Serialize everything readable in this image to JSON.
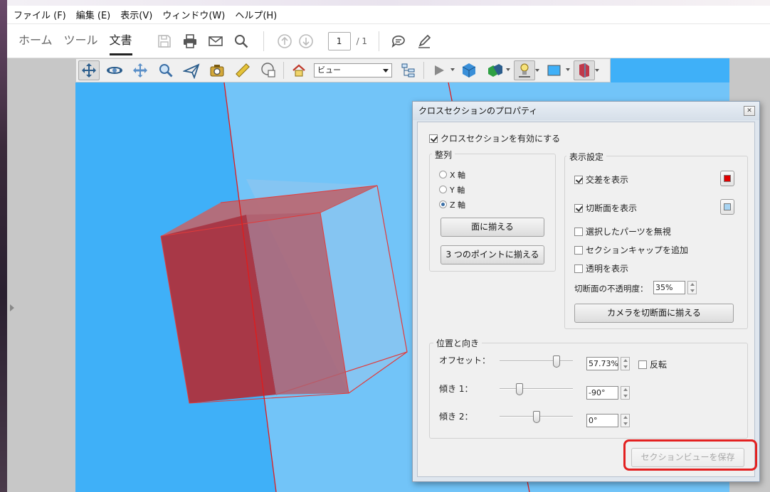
{
  "menu": [
    "ファイル (F)",
    "編集 (E)",
    "表示(V)",
    "ウィンドウ(W)",
    "ヘルプ(H)"
  ],
  "tabs": [
    {
      "label": "ホーム"
    },
    {
      "label": "ツール"
    },
    {
      "label": "文書"
    }
  ],
  "page": {
    "current": "1",
    "total": "/ 1"
  },
  "toolbar3d": {
    "view_select": "ビュー"
  },
  "colors": {
    "scene_bg": "#3fb0f8",
    "intersection_color": "#e00000",
    "cut_plane_color": "#a8d4f2",
    "highlight": "#e32020"
  },
  "dialog": {
    "title": "クロスセクションのプロパティ",
    "enable_label": "クロスセクションを有効にする",
    "enable_checked": true,
    "align": {
      "title": "整列",
      "options": [
        "X 軸",
        "Y 軸",
        "Z 軸"
      ],
      "selected": "Z 軸",
      "face_button": "面に揃える",
      "three_point_button": "3 つのポイントに揃える"
    },
    "display": {
      "title": "表示設定",
      "show_intersection": "交差を表示",
      "show_intersection_checked": true,
      "show_cut_plane": "切断面を表示",
      "show_cut_plane_checked": true,
      "ignore_selected": "選択したパーツを無視",
      "add_section_cap": "セクションキャップを追加",
      "show_transparency": "透明を表示",
      "opacity_label": "切断面の不透明度：",
      "opacity_value": "35%",
      "align_camera_button": "カメラを切断面に揃える"
    },
    "position": {
      "title": "位置と向き",
      "offset_label": "オフセット：",
      "offset_value": "57.73%",
      "offset_level": 0.78,
      "flip_label": "反転",
      "tilt1_label": "傾き 1：",
      "tilt1_value": "-90°",
      "tilt1_level": 0.27,
      "tilt2_label": "傾き 2：",
      "tilt2_value": "0°",
      "tilt2_level": 0.5
    },
    "save_button": "セクションビューを保存"
  }
}
